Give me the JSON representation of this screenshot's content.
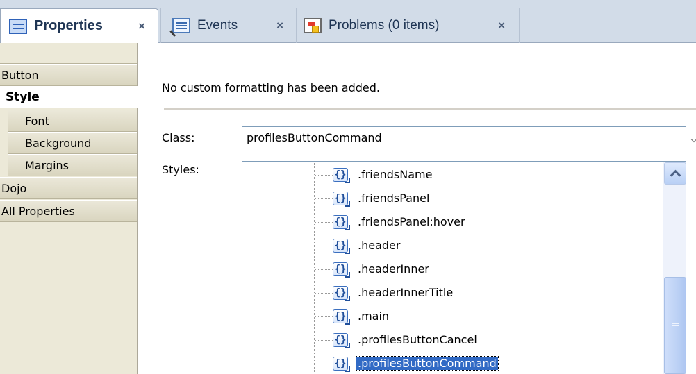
{
  "tabs": [
    {
      "label": "Properties",
      "icon": "properties-icon",
      "close": "×"
    },
    {
      "label": "Events",
      "icon": "events-icon",
      "close": "×"
    },
    {
      "label": "Problems (0 items)",
      "icon": "problems-icon",
      "close": "×"
    }
  ],
  "sidebar": {
    "items": [
      {
        "label": "Button"
      },
      {
        "label": "Style"
      },
      {
        "label": "Font"
      },
      {
        "label": "Background"
      },
      {
        "label": "Margins"
      },
      {
        "label": "Dojo"
      },
      {
        "label": "All Properties"
      }
    ]
  },
  "main": {
    "message": "No custom formatting has been added.",
    "class_label": "Class:",
    "class_value": "profilesButtonCommand",
    "styles_label": "Styles:",
    "styles": [
      {
        "name": ".friendsName",
        "icon": "css-rule-icon",
        "icon_glyph": "{}"
      },
      {
        "name": ".friendsPanel",
        "icon": "css-rule-icon",
        "icon_glyph": "{}"
      },
      {
        "name": ".friendsPanel:hover",
        "icon": "css-rule-icon",
        "icon_glyph": "{}"
      },
      {
        "name": ".header",
        "icon": "css-rule-icon",
        "icon_glyph": "{}"
      },
      {
        "name": ".headerInner",
        "icon": "css-rule-icon",
        "icon_glyph": "{}"
      },
      {
        "name": ".headerInnerTitle",
        "icon": "css-rule-icon",
        "icon_glyph": "{}"
      },
      {
        "name": ".main",
        "icon": "css-rule-icon",
        "icon_glyph": "{}"
      },
      {
        "name": ".profilesButtonCancel",
        "icon": "css-rule-icon",
        "icon_glyph": "{}"
      },
      {
        "name": ".profilesButtonCommand",
        "icon": "css-rule-icon",
        "icon_glyph": "{}",
        "selected": true
      }
    ]
  },
  "colors": {
    "tab_bar": "#d2dce8",
    "sidebar": "#ece9d8",
    "selection": "#316ac5",
    "input_border": "#7f9db9"
  }
}
